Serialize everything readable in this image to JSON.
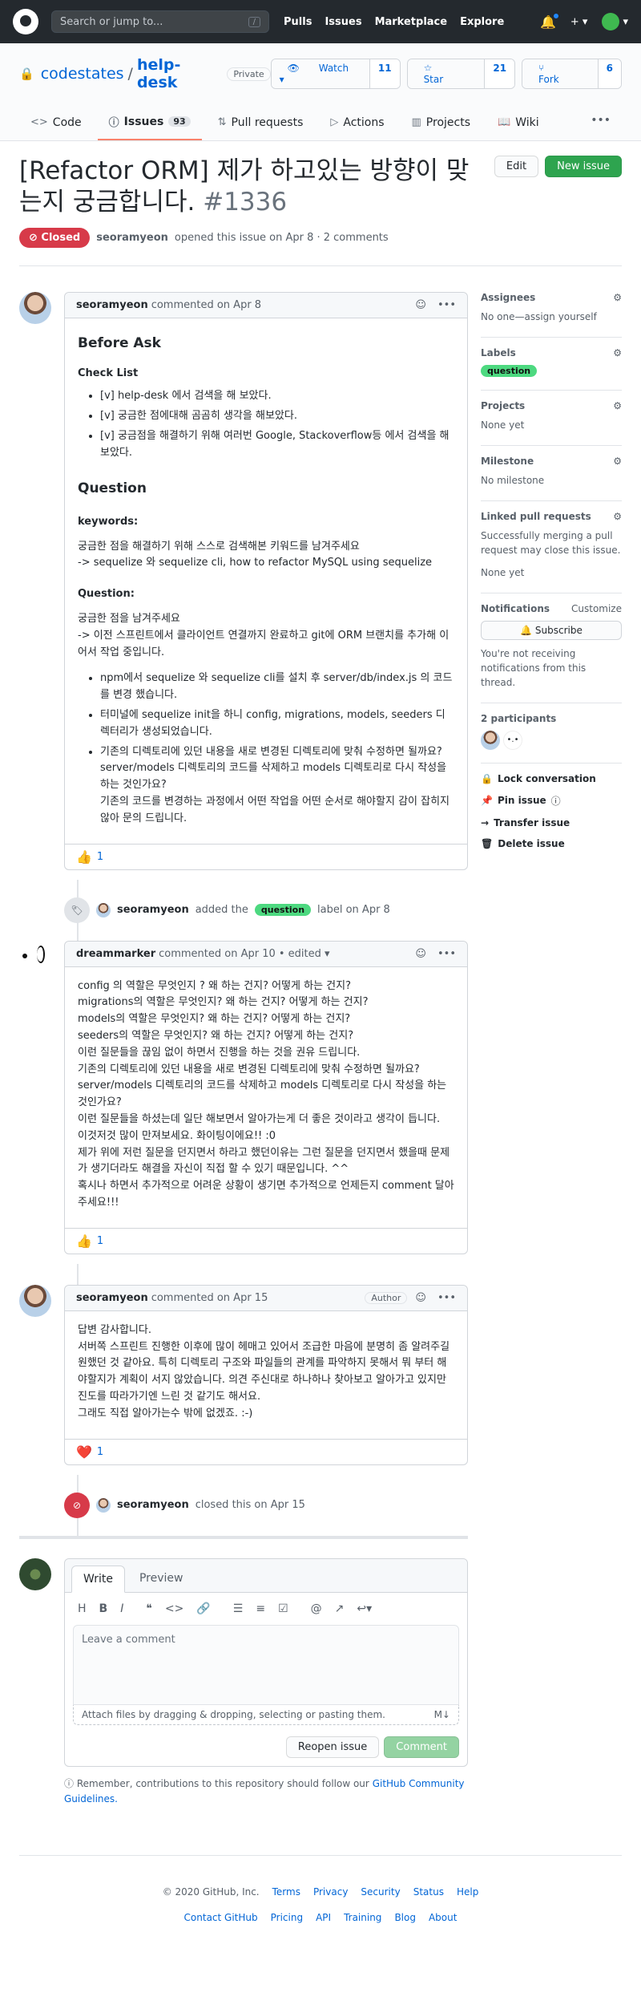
{
  "header": {
    "search_placeholder": "Search or jump to...",
    "search_key": "/",
    "nav": [
      "Pulls",
      "Issues",
      "Marketplace",
      "Explore"
    ]
  },
  "repo": {
    "owner": "codestates",
    "sep": "/",
    "name": "help-desk",
    "visibility": "Private",
    "watch_label": "Watch",
    "watch_count": "11",
    "star_label": "Star",
    "star_count": "21",
    "fork_label": "Fork",
    "fork_count": "6"
  },
  "tabs": {
    "code": "Code",
    "issues": "Issues",
    "issues_count": "93",
    "pulls": "Pull requests",
    "actions": "Actions",
    "projects": "Projects",
    "wiki": "Wiki"
  },
  "issue": {
    "title": "[Refactor ORM] 제가 하고있는 방향이 맞는지 궁금합니다.",
    "number": "#1336",
    "edit_label": "Edit",
    "new_issue_label": "New issue",
    "state": "Closed",
    "author": "seoramyeon",
    "meta_text": "opened this issue on Apr 8 · 2 comments"
  },
  "comment1": {
    "author": "seoramyeon",
    "meta": "commented on Apr 8",
    "h_before": "Before Ask",
    "h_checklist": "Check List",
    "checklist": [
      "[v] help-desk 에서 검색을 해 보았다.",
      "[v] 궁금한 점에대해 곰곰히 생각을 해보았다.",
      "[v] 궁금점을 해결하기 위해 여러번 Google, Stackoverflow등 에서 검색을 해보았다."
    ],
    "h_question": "Question",
    "h_keywords": "keywords:",
    "keywords_line1": "궁금한 점을 해결하기 위해 스스로 검색해본 키워드를 남겨주세요",
    "keywords_line2": "-> sequelize 와 sequelize cli, how to refactor MySQL using sequelize",
    "h_question2": "Question:",
    "question_text": "궁금한 점을 남겨주세요\n-> 이전 스프린트에서 클라이언트 연결까지 완료하고 git에 ORM 브랜치를 추가해 이어서 작업 중입니다.",
    "bullets": [
      "npm에서 sequelize 와 sequelize cli를 설치 후 server/db/index.js 의 코드를 변경 했습니다.",
      "터미널에 sequelize init을 하니 config, migrations, models, seeders 디렉터리가 생성되었습니다.",
      "기존의 디렉토리에 있던 내용을 새로 변경된 디렉토리에 맞춰 수정하면 될까요? server/models 디렉토리의 코드를 삭제하고 models 디렉토리로 다시 작성을 하는 것인가요?\n기존의 코드를 변경하는 과정에서 어떤 작업을 어떤 순서로 해야할지 감이 잡히지 않아 문의 드립니다."
    ],
    "reaction_emoji": "👍",
    "reaction_count": "1"
  },
  "event_label": {
    "author": "seoramyeon",
    "pre": "added the",
    "label": "question",
    "post": "label on Apr 8"
  },
  "comment2": {
    "author": "dreammarker",
    "meta": "commented on Apr 10 • edited",
    "body": "config 의 역할은 무엇인지 ? 왜 하는 건지? 어떻게 하는 건지?\nmigrations의 역할은 무엇인지? 왜 하는 건지? 어떻게 하는 건지?\nmodels의 역할은 무엇인지? 왜 하는 건지? 어떻게 하는 건지?\nseeders의 역할은 무엇인지? 왜 하는 건지? 어떻게 하는 건지?\n이런 질문들을 끊임 없이 하면서 진행을 하는 것을 권유 드립니다.\n기존의 디렉토리에 있던 내용을 새로 변경된 디렉토리에 맞춰 수정하면 될까요?\nserver/models 디렉토리의 코드를 삭제하고 models 디렉토리로 다시 작성을 하는 것인가요?\n이런 질문들을 하셨는데 일단 해보면서 알아가는게 더 좋은 것이라고 생각이 듭니다.\n이것저것 많이 만져보세요. 화이팅이에요!! :0\n제가 위에 저런 질문을 던지면서 하라고 했던이유는 그런 질문을 던지면서 했을때 문제가 생기더라도 해결을 자신이 직접 할 수 있기 때문입니다. ^^\n혹시나 하면서 추가적으로 어려운 상황이 생기면 추가적으로 언제든지 comment 달아주세요!!!",
    "reaction_emoji": "👍",
    "reaction_count": "1"
  },
  "comment3": {
    "author": "seoramyeon",
    "meta": "commented on Apr 15",
    "badge": "Author",
    "body": "답변 감사합니다.\n서버쪽 스프린트 진행한 이후에 많이 헤매고 있어서 조급한 마음에 분명히 좀 알려주길 원했던 것 같아요. 특히 디렉토리 구조와 파일들의 관계를 파악하지 못해서 뭐 부터 해야할지가 계획이 서지 않았습니다. 의견 주신대로 하나하나 찾아보고 알아가고 있지만 진도를 따라가기엔 느린 것 같기도 해서요.\n그래도 직접 알아가는수 밖에 없겠죠. :-)",
    "reaction_emoji": "❤️",
    "reaction_count": "1"
  },
  "event_closed": {
    "author": "seoramyeon",
    "text": "closed this on Apr 15"
  },
  "form": {
    "tab_write": "Write",
    "tab_preview": "Preview",
    "placeholder": "Leave a comment",
    "attach_text": "Attach files by dragging & dropping, selecting or pasting them.",
    "md_badge": "M↓",
    "reopen_label": "Reopen issue",
    "comment_label": "Comment",
    "remember_pre": "Remember, contributions to this repository should follow our",
    "remember_link": "GitHub Community Guidelines."
  },
  "sidebar": {
    "assignees_h": "Assignees",
    "assignees_v": "No one—assign yourself",
    "labels_h": "Labels",
    "label": "question",
    "projects_h": "Projects",
    "projects_v": "None yet",
    "milestone_h": "Milestone",
    "milestone_v": "No milestone",
    "linked_h": "Linked pull requests",
    "linked_v": "Successfully merging a pull request may close this issue.",
    "linked_v2": "None yet",
    "notif_h": "Notifications",
    "customize": "Customize",
    "subscribe": "Subscribe",
    "notif_v": "You're not receiving notifications from this thread.",
    "participants_h": "2 participants",
    "lock": "Lock conversation",
    "pin": "Pin issue",
    "transfer": "Transfer issue",
    "delete": "Delete issue"
  },
  "footer": {
    "copyright": "© 2020 GitHub, Inc.",
    "row1": [
      "Terms",
      "Privacy",
      "Security",
      "Status",
      "Help"
    ],
    "row2": [
      "Contact GitHub",
      "Pricing",
      "API",
      "Training",
      "Blog",
      "About"
    ]
  },
  "colors": {
    "closed": "#d73a49",
    "green": "#2ea44f",
    "label": "#4dd980",
    "link": "#0366d6"
  }
}
